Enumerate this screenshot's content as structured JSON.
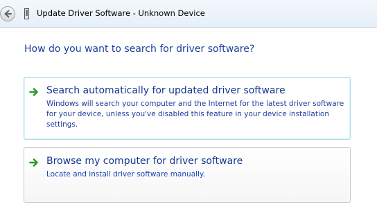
{
  "window": {
    "title": "Update Driver Software - Unknown Device"
  },
  "main": {
    "question": "How do you want to search for driver software?",
    "options": [
      {
        "title": "Search automatically for updated driver software",
        "description": "Windows will search your computer and the Internet for the latest driver software for your device, unless you've disabled this feature in your device installation settings.",
        "icon": "green-arrow-icon"
      },
      {
        "title": "Browse my computer for driver software",
        "description": "Locate and install driver software manually.",
        "icon": "green-arrow-icon"
      }
    ]
  },
  "colors": {
    "heading": "#1e3f9a",
    "link_title": "#14378f",
    "arrow": "#2e9a2a",
    "hover_border": "#a6dbe4"
  }
}
